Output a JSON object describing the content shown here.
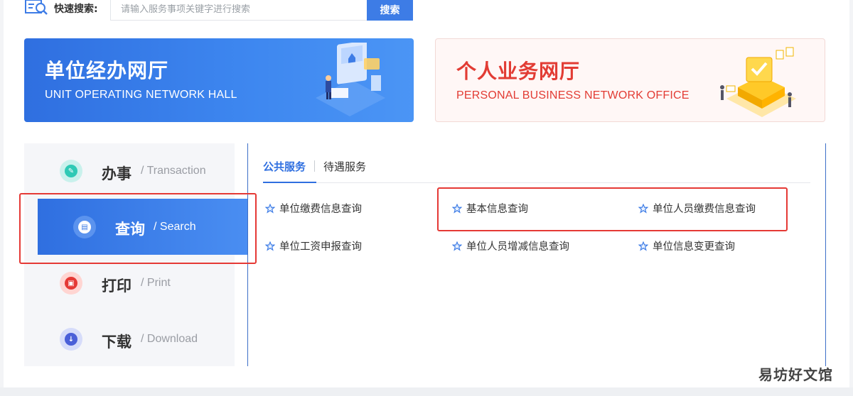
{
  "search": {
    "label": "快速搜索:",
    "placeholder": "请输入服务事项关键字进行搜索",
    "button_label": "搜索"
  },
  "banners": {
    "unit": {
      "title": "单位经办网厅",
      "subtitle": "UNIT OPERATING NETWORK HALL"
    },
    "personal": {
      "title": "个人业务网厅",
      "subtitle": "PERSONAL BUSINESS NETWORK OFFICE"
    }
  },
  "side_menu": {
    "items": [
      {
        "cn": "办事",
        "en": "/ Transaction",
        "icon": "pen-icon",
        "color": "#2fc9b5"
      },
      {
        "cn": "查询",
        "en": "/ Search",
        "icon": "document-icon",
        "color": "#ffffff",
        "active": true
      },
      {
        "cn": "打印",
        "en": "/ Print",
        "icon": "printer-icon",
        "color": "#e53935"
      },
      {
        "cn": "下载",
        "en": "/ Download",
        "icon": "download-icon",
        "color": "#4a5fd8"
      }
    ]
  },
  "tabs": [
    {
      "label": "公共服务",
      "active": true
    },
    {
      "label": "待遇服务",
      "active": false
    }
  ],
  "services": [
    {
      "label": "单位缴费信息查询"
    },
    {
      "label": "基本信息查询"
    },
    {
      "label": "单位人员缴费信息查询"
    },
    {
      "label": "单位工资申报查询"
    },
    {
      "label": "单位人员增减信息查询"
    },
    {
      "label": "单位信息变更查询"
    }
  ],
  "watermark": "易坊好文馆",
  "colors": {
    "primary": "#2f6fe0",
    "annotation_red": "#e53935",
    "personal_red": "#e23c34"
  }
}
